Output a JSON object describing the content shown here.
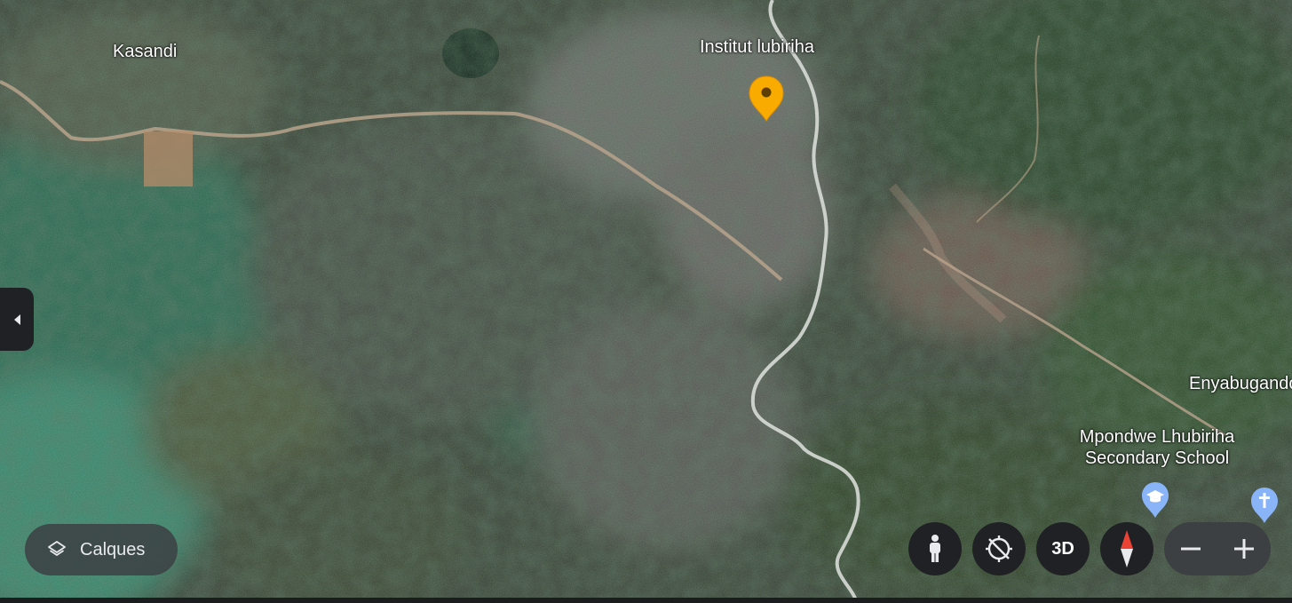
{
  "map": {
    "labels": {
      "kasandi": "Kasandi",
      "institut": "Institut lubiriha",
      "enyabugando": "Enyabugando",
      "school_line1": "Mpondwe Lhubiriha",
      "school_line2": "Secondary School"
    },
    "pins": {
      "selected_marker_color": "#f9ab00",
      "school_icon": "graduation-cap-icon",
      "church_icon": "cross-icon",
      "poi_pin_color": "#8ab4f8"
    }
  },
  "controls": {
    "side_panel_toggle_icon": "chevron-left-icon",
    "layers": {
      "icon": "layers-icon",
      "label": "Calques"
    },
    "street_view_icon": "pegman-icon",
    "no_tilt_icon": "rotate-off-icon",
    "view_3d_label": "3D",
    "compass_icon": "compass-icon",
    "zoom_out_icon": "minus-icon",
    "zoom_in_icon": "plus-icon"
  },
  "colors": {
    "control_bg": "#202124",
    "zoom_group_bg": "#3c4043",
    "compass_red": "#ea4335",
    "label_text": "#ffffff"
  }
}
